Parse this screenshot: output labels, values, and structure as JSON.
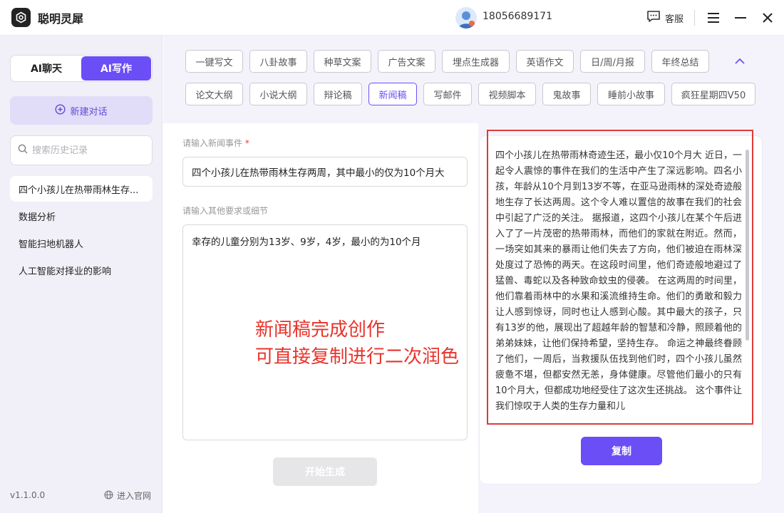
{
  "app": {
    "name": "聪明灵犀",
    "logo_icon": "app-logo-icon"
  },
  "header": {
    "phone": "18056689171",
    "support_label": "客服",
    "menu_icon": "menu-icon",
    "minimize_icon": "minimize-icon",
    "close_icon": "close-icon"
  },
  "sidebar": {
    "mode_tabs": [
      {
        "label": "AI聊天",
        "active": false
      },
      {
        "label": "AI写作",
        "active": true
      }
    ],
    "new_chat_label": "新建对话",
    "search_placeholder": "搜索历史记录",
    "history": [
      {
        "label": "四个小孩儿在热带雨林生存...",
        "active": true
      },
      {
        "label": "数据分析",
        "active": false
      },
      {
        "label": "智能扫地机器人",
        "active": false
      },
      {
        "label": "人工智能对择业的影响",
        "active": false
      }
    ],
    "version": "v1.1.0.0",
    "website_label": "进入官网"
  },
  "tags": [
    {
      "label": "一键写文"
    },
    {
      "label": "八卦故事"
    },
    {
      "label": "种草文案"
    },
    {
      "label": "广告文案"
    },
    {
      "label": "埋点生成器"
    },
    {
      "label": "英语作文"
    },
    {
      "label": "日/周/月报"
    },
    {
      "label": "年终总结"
    },
    {
      "label": "论文大纲"
    },
    {
      "label": "小说大纲"
    },
    {
      "label": "辩论稿"
    },
    {
      "label": "新闻稿",
      "active": true
    },
    {
      "label": "写邮件"
    },
    {
      "label": "视频脚本"
    },
    {
      "label": "鬼故事"
    },
    {
      "label": "睡前小故事"
    },
    {
      "label": "疯狂星期四V50"
    }
  ],
  "form": {
    "event_label": "请输入新闻事件",
    "required_mark": "*",
    "event_value": "四个小孩儿在热带雨林生存两周，其中最小的仅为10个月大",
    "detail_label": "请输入其他要求或细节",
    "detail_value": "幸存的儿童分别为13岁、9岁，4岁，最小的为10个月",
    "generate_label": "开始生成"
  },
  "result": {
    "text": "四个小孩儿在热带雨林奇迹生还，最小仅10个月大 近日，一起令人震惊的事件在我们的生活中产生了深远影响。四名小孩，年龄从10个月到13岁不等，在亚马逊雨林的深处奇迹般地生存了长达两周。这个令人难以置信的故事在我们的社会中引起了广泛的关注。 据报道，这四个小孩儿在某个午后进入了了一片茂密的热带雨林，而他们的家就在附近。然而，一场突如其来的暴雨让他们失去了方向，他们被迫在雨林深处度过了恐怖的两天。在这段时间里，他们奇迹般地避过了猛兽、毒蛇以及各种致命蚊虫的侵袭。 在这两周的时间里，他们靠着雨林中的水果和溪流维持生命。他们的勇敢和毅力让人感到惊讶，同时也让人感到心酸。其中最大的孩子，只有13岁的他，展现出了超越年龄的智慧和冷静，照顾着他的弟弟妹妹，让他们保持希望，坚持生存。 命运之神最终眷顾了他们，一周后，当救援队伍找到他们时，四个小孩儿虽然疲惫不堪，但都安然无恙，身体健康。尽管他们最小的只有10个月大，但都成功地经受住了这次生还挑战。 这个事件让我们惊叹于人类的生存力量和儿",
    "copy_label": "复制"
  },
  "annotation": {
    "line1": "新闻稿完成创作",
    "line2": "可直接复制进行二次润色",
    "color": "#e8332a"
  },
  "colors": {
    "accent": "#6b4ef6",
    "highlight_frame": "#e03a3a"
  }
}
